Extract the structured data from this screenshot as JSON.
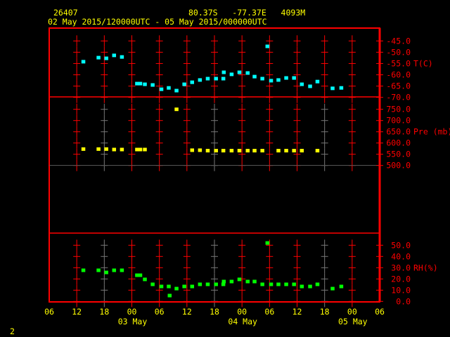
{
  "header": {
    "station_id": "26407",
    "location": "80.37S   -77.37E   4093M",
    "time_range": "02 May 2015/120000UTC - 05 May 2015/000000UTC"
  },
  "footer": {
    "page_number": "2"
  },
  "colors": {
    "temperature": "#00ffff",
    "pressure": "#ffff00",
    "rh": "#00ff00",
    "axis": "#ff0000",
    "text": "#ffff00"
  },
  "chart_data": {
    "type": "scatter",
    "x_unit": "hours since 02 May 06UTC",
    "xlim": [
      0,
      72
    ],
    "x_tick_labels": [
      "06",
      "12",
      "18",
      "00",
      "06",
      "12",
      "18",
      "00",
      "06",
      "12",
      "18",
      "00",
      "06"
    ],
    "x_date_labels": [
      {
        "hour": 18,
        "label": "03 May"
      },
      {
        "hour": 42,
        "label": "04 May"
      },
      {
        "hour": 66,
        "label": "05 May"
      }
    ],
    "panels": [
      {
        "name": "temperature",
        "label": "T(C)",
        "ylim": [
          -70,
          -45
        ],
        "tick_labels": [
          "-45.0",
          "-50.0",
          "-55.0",
          "-60.0",
          "-65.0",
          "-70.0"
        ],
        "points": [
          [
            7.4,
            -54.2
          ],
          [
            10.7,
            -52.4
          ],
          [
            12.4,
            -52.7
          ],
          [
            14.1,
            -51.4
          ],
          [
            15.8,
            -52.1
          ],
          [
            19.1,
            -63.9
          ],
          [
            19.8,
            -63.9
          ],
          [
            20.8,
            -64.2
          ],
          [
            22.5,
            -64.5
          ],
          [
            24.4,
            -66.4
          ],
          [
            26.0,
            -65.8
          ],
          [
            27.7,
            -67.0
          ],
          [
            29.4,
            -64.2
          ],
          [
            31.1,
            -63.3
          ],
          [
            32.8,
            -62.3
          ],
          [
            34.5,
            -61.7
          ],
          [
            36.3,
            -61.7
          ],
          [
            37.9,
            -61.7
          ],
          [
            38.0,
            -58.9
          ],
          [
            39.7,
            -59.8
          ],
          [
            41.4,
            -58.9
          ],
          [
            43.2,
            -59.2
          ],
          [
            44.7,
            -60.8
          ],
          [
            46.4,
            -61.7
          ],
          [
            47.5,
            -47.4
          ],
          [
            48.3,
            -62.6
          ],
          [
            49.9,
            -62.3
          ],
          [
            51.6,
            -61.4
          ],
          [
            53.3,
            -61.4
          ],
          [
            55.0,
            -64.2
          ],
          [
            56.8,
            -65.1
          ],
          [
            58.4,
            -63.0
          ],
          [
            61.7,
            -66.0
          ],
          [
            63.6,
            -65.8
          ]
        ]
      },
      {
        "name": "pressure",
        "label": "Pre (mb)",
        "ylim": [
          500,
          750
        ],
        "tick_labels": [
          "750.0",
          "700.0",
          "650.0",
          "600.0",
          "550.0",
          "500.0"
        ],
        "points": [
          [
            7.4,
            573
          ],
          [
            10.7,
            573
          ],
          [
            12.4,
            573
          ],
          [
            14.1,
            571
          ],
          [
            15.8,
            571
          ],
          [
            19.1,
            571
          ],
          [
            19.8,
            571
          ],
          [
            20.8,
            571
          ],
          [
            27.7,
            750
          ],
          [
            31.1,
            568
          ],
          [
            32.8,
            568
          ],
          [
            34.5,
            566
          ],
          [
            36.3,
            566
          ],
          [
            37.9,
            566
          ],
          [
            39.7,
            566
          ],
          [
            41.4,
            566
          ],
          [
            43.2,
            566
          ],
          [
            44.7,
            566
          ],
          [
            46.4,
            566
          ],
          [
            49.9,
            566
          ],
          [
            51.6,
            566
          ],
          [
            53.3,
            566
          ],
          [
            55.0,
            566
          ],
          [
            58.4,
            566
          ]
        ]
      },
      {
        "name": "rh",
        "label": "RH(%)",
        "ylim": [
          0,
          50
        ],
        "tick_labels": [
          "50.0",
          "40.0",
          "30.0",
          "20.0",
          "10.0",
          "0.0"
        ],
        "points": [
          [
            7.4,
            27.7
          ],
          [
            10.7,
            27.7
          ],
          [
            12.4,
            25.8
          ],
          [
            14.1,
            27.7
          ],
          [
            15.8,
            27.7
          ],
          [
            19.1,
            23.3
          ],
          [
            19.8,
            23.3
          ],
          [
            20.8,
            19.6
          ],
          [
            22.5,
            15.2
          ],
          [
            24.4,
            13.3
          ],
          [
            26.0,
            13.3
          ],
          [
            26.2,
            5.2
          ],
          [
            27.7,
            11.4
          ],
          [
            29.4,
            13.3
          ],
          [
            31.1,
            13.3
          ],
          [
            32.8,
            15.2
          ],
          [
            34.5,
            15.2
          ],
          [
            36.3,
            15.2
          ],
          [
            37.9,
            15.2
          ],
          [
            38.0,
            17.7
          ],
          [
            39.7,
            17.7
          ],
          [
            41.4,
            19.6
          ],
          [
            43.2,
            17.7
          ],
          [
            44.7,
            17.7
          ],
          [
            46.4,
            15.2
          ],
          [
            47.5,
            52.0
          ],
          [
            48.3,
            15.2
          ],
          [
            49.9,
            15.2
          ],
          [
            51.6,
            15.2
          ],
          [
            53.3,
            15.2
          ],
          [
            55.0,
            13.3
          ],
          [
            56.8,
            13.3
          ],
          [
            58.4,
            15.2
          ],
          [
            61.7,
            11.4
          ],
          [
            63.6,
            13.3
          ]
        ]
      }
    ]
  }
}
